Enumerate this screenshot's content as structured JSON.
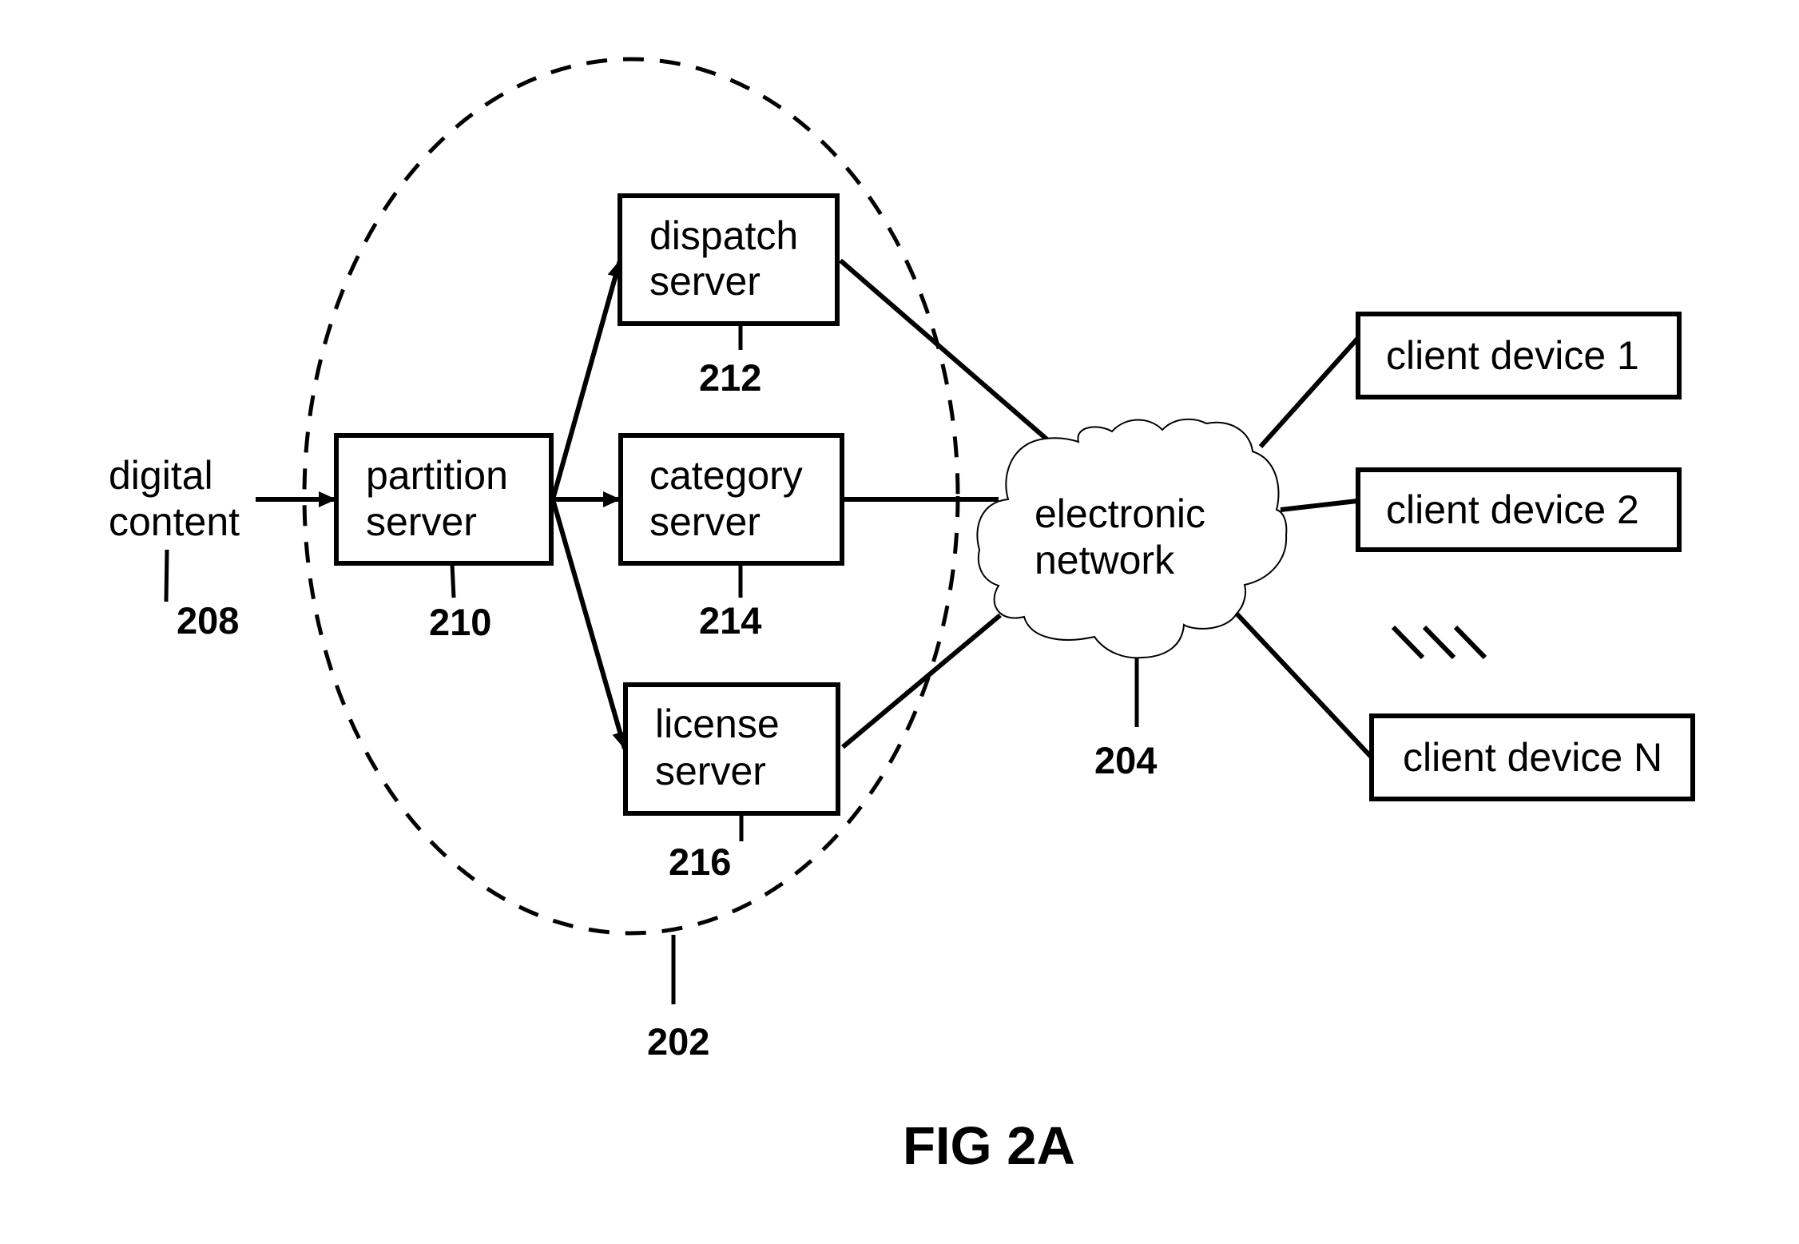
{
  "figure": {
    "caption": "FIG 2A",
    "input": {
      "label_lines": [
        "digital",
        "content"
      ],
      "ref": "208"
    },
    "server_group": {
      "ref": "202"
    },
    "servers": [
      {
        "id": "partition",
        "label_lines": [
          "partition",
          "server"
        ],
        "ref": "210"
      },
      {
        "id": "dispatch",
        "label_lines": [
          "dispatch",
          "server"
        ],
        "ref": "212"
      },
      {
        "id": "category",
        "label_lines": [
          "category",
          "server"
        ],
        "ref": "214"
      },
      {
        "id": "license",
        "label_lines": [
          "license",
          "server"
        ],
        "ref": "216"
      }
    ],
    "network": {
      "label_lines": [
        "electronic",
        "network"
      ],
      "ref": "204"
    },
    "clients": [
      {
        "label": "client device 1"
      },
      {
        "label": "client device 2"
      },
      {
        "label": "client device N"
      }
    ],
    "edges": [
      {
        "from": "digital content",
        "to": "partition server",
        "type": "arrow"
      },
      {
        "from": "partition server",
        "to": "dispatch server",
        "type": "arrow"
      },
      {
        "from": "partition server",
        "to": "category server",
        "type": "arrow"
      },
      {
        "from": "partition server",
        "to": "license server",
        "type": "arrow"
      },
      {
        "from": "dispatch server",
        "to": "electronic network",
        "type": "line"
      },
      {
        "from": "category server",
        "to": "electronic network",
        "type": "line"
      },
      {
        "from": "license server",
        "to": "electronic network",
        "type": "line"
      },
      {
        "from": "electronic network",
        "to": "client device 1",
        "type": "line"
      },
      {
        "from": "electronic network",
        "to": "client device 2",
        "type": "line"
      },
      {
        "from": "electronic network",
        "to": "client device N",
        "type": "line"
      }
    ]
  }
}
